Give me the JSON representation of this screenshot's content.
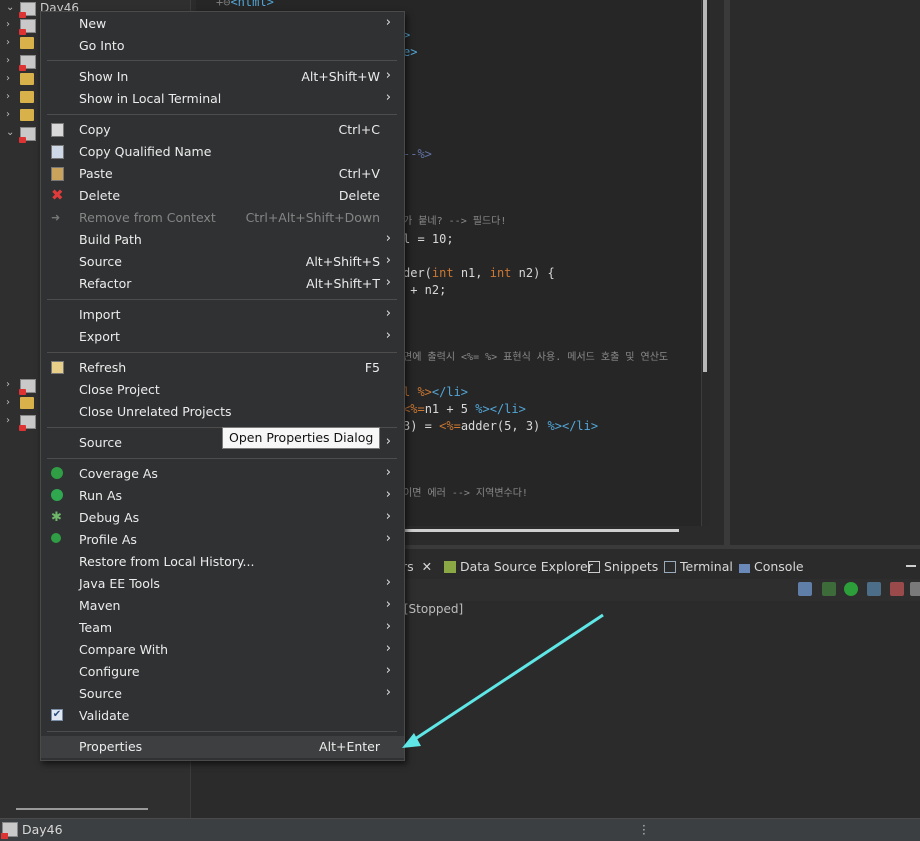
{
  "explorer": {
    "root_label": "Day46"
  },
  "editor": {
    "lines": {
      "l0": "<html>",
      "l1": ">",
      "l2": "e>",
      "l3": "--%>",
      "l4": "가 붙네? --> 필드다!",
      "l5": "l = 10;",
      "l6a": "der(",
      "l6b": "int",
      "l6c": " n1, ",
      "l6d": "int",
      "l6e": " n2) {",
      "l7": " + n2;",
      "l8": "면에 출력시 <%= %> 표현식 사용. 메서드 호출 및 연산도",
      "l9a": "l %>",
      "l9b": "</li>",
      "l10a": "<%=",
      "l10b": "n1 + 5 ",
      "l10c": "%></li>",
      "l11a": "3) = ",
      "l11b": "<%=",
      "l11c": "adder(5, 3) ",
      "l11d": "%></li>",
      "l12": "이면 에러 --> 지역변수다!"
    }
  },
  "bottom_panel": {
    "tabs": {
      "servers": "rs",
      "data_source": "Data Source Explorer",
      "snippets": "Snippets",
      "terminal": "Terminal",
      "console": "Console"
    },
    "console_line": ": [Stopped]"
  },
  "context_menu": {
    "new": "New",
    "go_into": "Go Into",
    "show_in": "Show In",
    "show_in_shortcut": "Alt+Shift+W",
    "show_in_terminal": "Show in Local Terminal",
    "copy": "Copy",
    "copy_shortcut": "Ctrl+C",
    "copy_qualified": "Copy Qualified Name",
    "paste": "Paste",
    "paste_shortcut": "Ctrl+V",
    "delete": "Delete",
    "delete_shortcut": "Delete",
    "remove_context": "Remove from Context",
    "remove_context_shortcut": "Ctrl+Alt+Shift+Down",
    "build_path": "Build Path",
    "source": "Source",
    "source_shortcut": "Alt+Shift+S",
    "refactor": "Refactor",
    "refactor_shortcut": "Alt+Shift+T",
    "import": "Import",
    "export": "Export",
    "refresh": "Refresh",
    "refresh_shortcut": "F5",
    "close_project": "Close Project",
    "close_unrelated": "Close Unrelated Projects",
    "source2": "Source",
    "coverage_as": "Coverage As",
    "run_as": "Run As",
    "debug_as": "Debug As",
    "profile_as": "Profile As",
    "restore_history": "Restore from Local History...",
    "java_ee_tools": "Java EE Tools",
    "maven": "Maven",
    "team": "Team",
    "compare_with": "Compare With",
    "configure": "Configure",
    "source3": "Source",
    "validate": "Validate",
    "properties": "Properties",
    "properties_shortcut": "Alt+Enter",
    "submenu_arrow": "›"
  },
  "tooltip": "Open Properties Dialog",
  "status_bar": {
    "label": "Day46"
  },
  "colors": {
    "annotation_arrow": "#5fe6e6",
    "menu_background": "#2f3133"
  }
}
